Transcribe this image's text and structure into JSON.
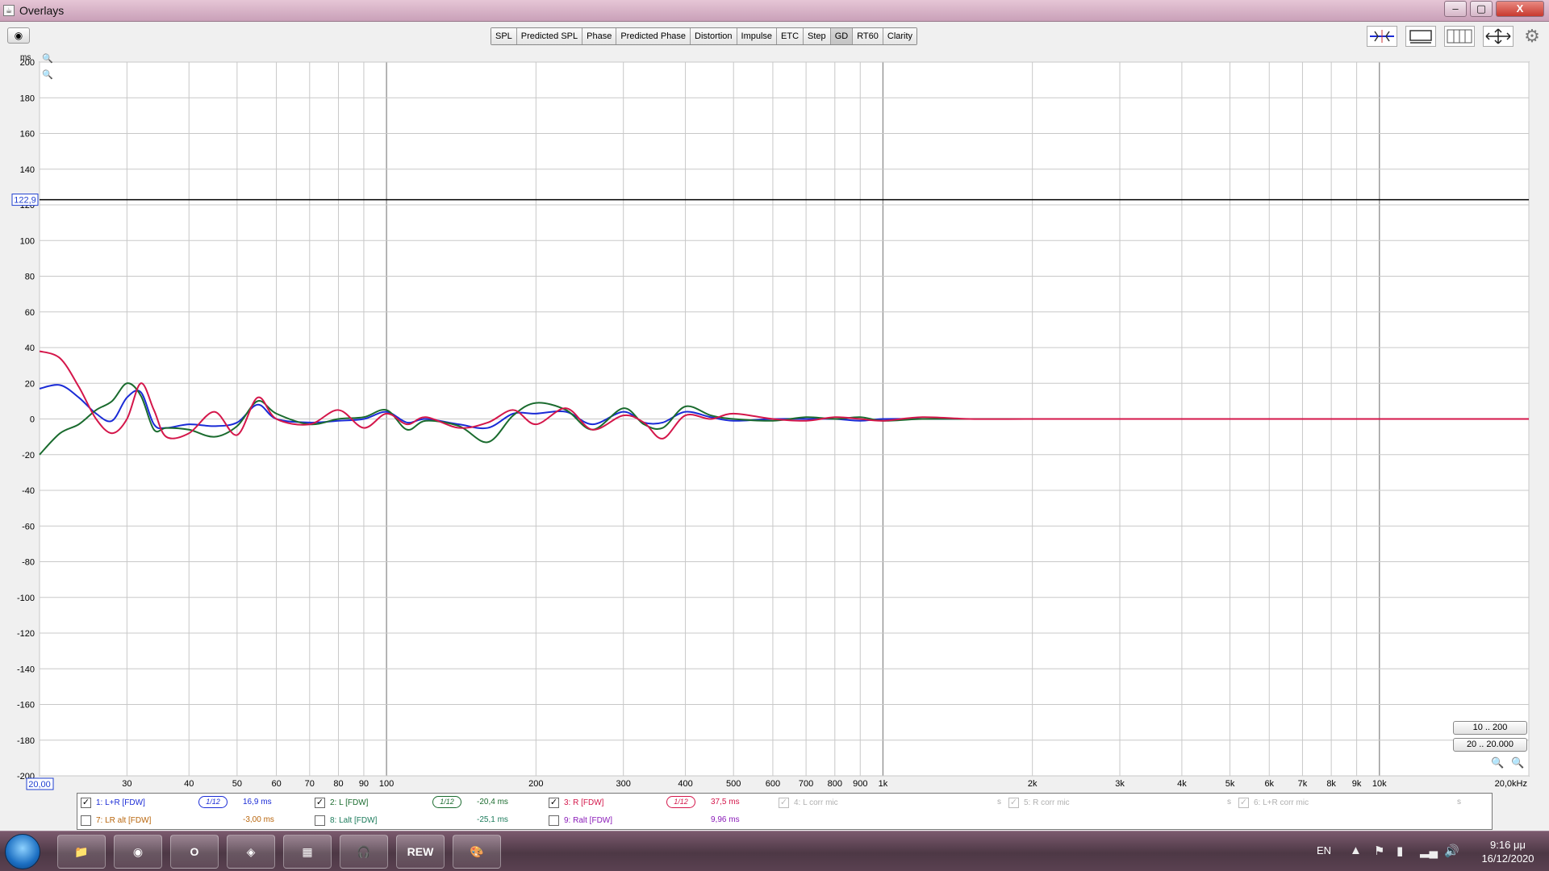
{
  "window": {
    "title": "Overlays",
    "controls": {
      "minimize": "–",
      "maximize": "▢",
      "close": "X"
    }
  },
  "toolbar": {
    "camera_icon": "camera-icon",
    "tabs": [
      {
        "label": "SPL",
        "active": false
      },
      {
        "label": "Predicted SPL",
        "active": false
      },
      {
        "label": "Phase",
        "active": false
      },
      {
        "label": "Predicted Phase",
        "active": false
      },
      {
        "label": "Distortion",
        "active": false
      },
      {
        "label": "Impulse",
        "active": false
      },
      {
        "label": "ETC",
        "active": false
      },
      {
        "label": "Step",
        "active": false
      },
      {
        "label": "GD",
        "active": true
      },
      {
        "label": "RT60",
        "active": false
      },
      {
        "label": "Clarity",
        "active": false
      }
    ],
    "tool_icons": [
      "align-traces-icon",
      "window-view-icon",
      "grid-view-icon",
      "zoom-fit-icon",
      "gear-icon"
    ]
  },
  "graph": {
    "y_unit": "ms",
    "y_ticks": [
      "200",
      "180",
      "160",
      "140",
      "120",
      "100",
      "80",
      "60",
      "40",
      "20",
      "0",
      "-20",
      "-40",
      "-60",
      "-80",
      "-100",
      "-120",
      "-140",
      "-160",
      "-180",
      "-200"
    ],
    "cursor_y_value": "122,9",
    "cursor_x_value": "20,00",
    "x_ticks": [
      "30",
      "40",
      "50",
      "60",
      "70",
      "80",
      "90",
      "100",
      "200",
      "300",
      "400",
      "500",
      "600",
      "700",
      "800",
      "900",
      "1k",
      "2k",
      "3k",
      "4k",
      "5k",
      "6k",
      "7k",
      "8k",
      "9k",
      "10k",
      "20,0kHz"
    ],
    "range_buttons": [
      "10 .. 200",
      "20 .. 20.000"
    ],
    "colors": {
      "background": "#ffffff",
      "grid": "#c8c8c8",
      "major_grid": "#8c8c8c",
      "cursor": "#000000",
      "axis_text": "#000000",
      "cursor_label": "#1f3fd0"
    }
  },
  "chart_data": {
    "type": "line",
    "title": "",
    "xlabel": "",
    "ylabel": "ms",
    "x_scale": "log",
    "xlim": [
      20,
      20000
    ],
    "ylim": [
      -200,
      200
    ],
    "grid": true,
    "series": [
      {
        "name": "1: L+R [FDW]",
        "color": "#1a2bd6",
        "x": [
          20,
          22,
          24,
          26,
          28,
          30,
          32,
          34,
          36,
          40,
          45,
          50,
          55,
          60,
          70,
          80,
          90,
          100,
          110,
          120,
          140,
          160,
          180,
          200,
          230,
          260,
          300,
          330,
          360,
          400,
          450,
          500,
          600,
          700,
          800,
          900,
          1000,
          1200,
          1500,
          2000,
          3000,
          5000,
          10000,
          20000
        ],
        "y": [
          17,
          19,
          12,
          3,
          -1,
          12,
          15,
          -3,
          -5,
          -3,
          -4,
          -2,
          8,
          0,
          -2,
          -1,
          0,
          4,
          -2,
          0,
          -3,
          -5,
          3,
          3,
          4,
          -3,
          4,
          -2,
          -2,
          4,
          1,
          -1,
          0,
          0,
          0,
          -1,
          0,
          0,
          0,
          0,
          0,
          0,
          0,
          0
        ]
      },
      {
        "name": "2: L [FDW]",
        "color": "#1a6b2e",
        "x": [
          20,
          22,
          24,
          26,
          28,
          30,
          32,
          34,
          36,
          40,
          45,
          50,
          55,
          60,
          70,
          80,
          90,
          100,
          110,
          120,
          140,
          160,
          180,
          200,
          230,
          260,
          300,
          330,
          360,
          400,
          450,
          500,
          600,
          700,
          800,
          900,
          1000,
          1200,
          1500,
          2000,
          3000,
          5000,
          10000,
          20000
        ],
        "y": [
          -20,
          -8,
          -3,
          5,
          10,
          20,
          13,
          -6,
          -5,
          -6,
          -10,
          -4,
          10,
          3,
          -3,
          0,
          1,
          5,
          -6,
          -1,
          -4,
          -13,
          2,
          9,
          5,
          -6,
          6,
          -3,
          -5,
          7,
          2,
          0,
          -1,
          1,
          0,
          1,
          -1,
          0,
          0,
          0,
          0,
          0,
          0,
          0
        ]
      },
      {
        "name": "3: R [FDW]",
        "color": "#d4164a",
        "x": [
          20,
          22,
          24,
          26,
          28,
          30,
          32,
          34,
          36,
          40,
          45,
          50,
          55,
          60,
          70,
          80,
          90,
          100,
          110,
          120,
          140,
          160,
          180,
          200,
          230,
          260,
          300,
          330,
          360,
          400,
          450,
          500,
          600,
          700,
          800,
          900,
          1000,
          1200,
          1500,
          2000,
          3000,
          5000,
          10000,
          20000
        ],
        "y": [
          38,
          34,
          18,
          0,
          -8,
          0,
          20,
          5,
          -10,
          -8,
          4,
          -9,
          12,
          0,
          -3,
          5,
          -5,
          3,
          -3,
          1,
          -5,
          -2,
          5,
          -3,
          6,
          -6,
          2,
          -2,
          -11,
          2,
          0,
          3,
          0,
          -1,
          1,
          0,
          -1,
          1,
          0,
          0,
          0,
          0,
          0,
          0
        ]
      }
    ]
  },
  "legend": {
    "rows": [
      [
        {
          "label": "1: L+R [FDW]",
          "checked": true,
          "enabled": true,
          "color": "#1a2bd6",
          "smoothing": "1/12",
          "value": "16,9 ms"
        },
        {
          "label": "2: L [FDW]",
          "checked": true,
          "enabled": true,
          "color": "#1a6b2e",
          "smoothing": "1/12",
          "value": "-20,4 ms"
        },
        {
          "label": "3: R [FDW]",
          "checked": true,
          "enabled": true,
          "color": "#d4164a",
          "smoothing": "1/12",
          "value": "37,5 ms"
        },
        {
          "label": "4: L corr mic",
          "checked": true,
          "enabled": false,
          "color": "#b0b0b0",
          "smoothing": "",
          "value": "s"
        },
        {
          "label": "5: R corr mic",
          "checked": true,
          "enabled": false,
          "color": "#b0b0b0",
          "smoothing": "",
          "value": "s"
        },
        {
          "label": "6: L+R corr mic",
          "checked": true,
          "enabled": false,
          "color": "#b0b0b0",
          "smoothing": "",
          "value": "s"
        }
      ],
      [
        {
          "label": "7: LR alt [FDW]",
          "checked": false,
          "enabled": true,
          "color": "#b8650c",
          "smoothing": "",
          "value": "-3,00 ms"
        },
        {
          "label": "8: Lalt [FDW]",
          "checked": false,
          "enabled": true,
          "color": "#1a7a5a",
          "smoothing": "",
          "value": "-25,1 ms"
        },
        {
          "label": "9: Ralt [FDW]",
          "checked": false,
          "enabled": true,
          "color": "#8a1ab8",
          "smoothing": "",
          "value": "9,96 ms"
        }
      ]
    ]
  },
  "taskbar": {
    "apps": [
      {
        "name": "file-explorer-icon",
        "glyph": "📁"
      },
      {
        "name": "chrome-icon",
        "glyph": "◉"
      },
      {
        "name": "opera-icon",
        "glyph": "O"
      },
      {
        "name": "vpn-shield-icon",
        "glyph": "◈"
      },
      {
        "name": "filezilla-icon",
        "glyph": "▦"
      },
      {
        "name": "headphones-app-icon",
        "glyph": "🎧"
      },
      {
        "name": "rew-icon",
        "glyph": "REW"
      },
      {
        "name": "paint-icon",
        "glyph": "🎨"
      }
    ],
    "language": "EN",
    "time": "9:16 μμ",
    "date": "16/12/2020"
  }
}
